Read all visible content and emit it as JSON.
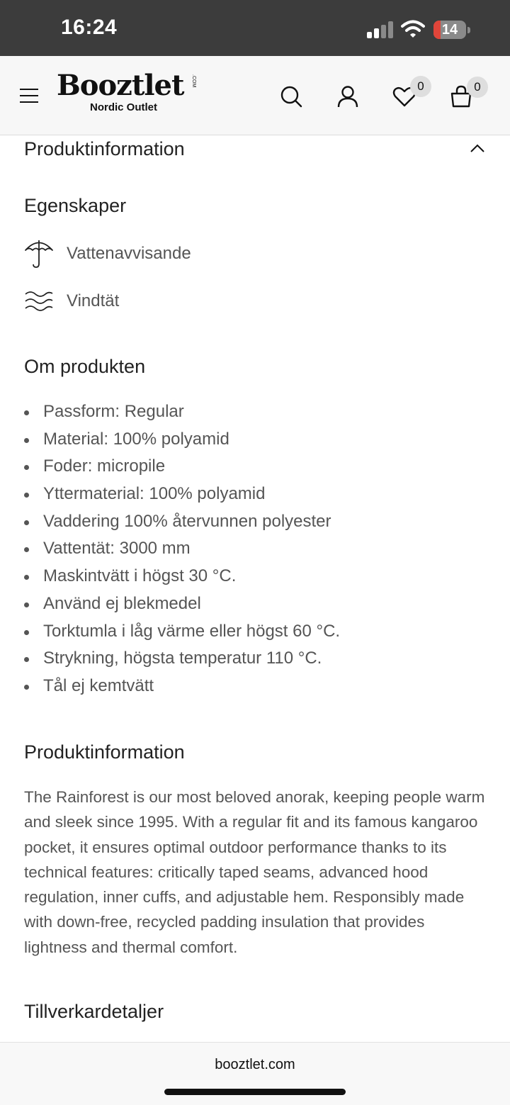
{
  "status_bar": {
    "time": "16:24",
    "battery": "14",
    "icons": [
      "signal-icon",
      "wifi-icon",
      "battery-icon"
    ],
    "battery_color": "#e0453a"
  },
  "header": {
    "brand": "Booztlet",
    "brand_suffix": ".COM",
    "tagline": "Nordic Outlet",
    "wishlist_count": "0",
    "cart_count": "0",
    "icons": [
      "menu-icon",
      "search-icon",
      "user-icon",
      "heart-icon",
      "bag-icon"
    ]
  },
  "section": {
    "title": "Produktinformation"
  },
  "features": {
    "heading": "Egenskaper",
    "items": [
      {
        "label": "Vattenavvisande",
        "icon": "umbrella-icon"
      },
      {
        "label": "Vindtät",
        "icon": "wind-icon"
      }
    ]
  },
  "about": {
    "heading": "Om produkten",
    "bullets": [
      "Passform: Regular",
      "Material: 100% polyamid",
      "Foder: micropile",
      "Yttermaterial: 100% polyamid",
      "Vaddering 100% återvunnen polyester",
      "Vattentät: 3000 mm",
      "Maskintvätt i högst 30 °C.",
      "Använd ej blekmedel",
      "Torktumla i låg värme eller högst 60 °C.",
      "Strykning, högsta temperatur 110 °C.",
      "Tål ej kemtvätt"
    ]
  },
  "product_info": {
    "heading": "Produktinformation",
    "text": "The Rainforest is our most beloved anorak, keeping people warm and sleek since 1995. With a regular fit and its famous kangaroo pocket, it ensures optimal outdoor performance thanks to its technical features: critically taped seams, advanced hood regulation, inner cuffs, and adjustable hem. Responsibly made with down-free, recycled padding insulation that provides lightness and thermal comfort."
  },
  "manufacturing": {
    "heading": "Tillverkardetaljer"
  },
  "browser": {
    "url": "booztlet.com"
  }
}
